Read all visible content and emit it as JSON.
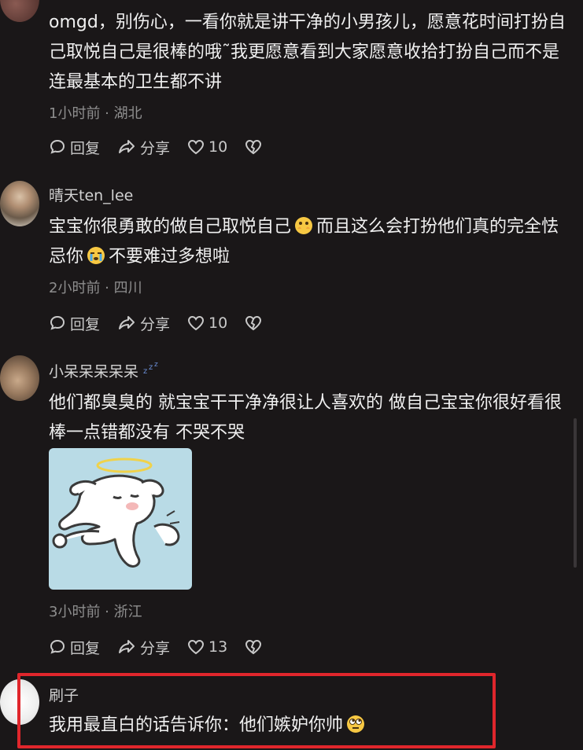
{
  "comments": [
    {
      "username": "",
      "text": "omgd，别伤心，一看你就是讲干净的小男孩儿，愿意花时间打扮自己取悦自己是很棒的哦˜我更愿意看到大家愿意收拾打扮自己而不是连最基本的卫生都不讲",
      "meta": "1小时前 · 湖北",
      "reply": "回复",
      "share": "分享",
      "likes": "10"
    },
    {
      "username": "晴天ten_lee",
      "text_a": "宝宝你很勇敢的做自己取悦自己",
      "text_b": "而且这么会打扮他们真的完全怯忌你",
      "text_c": "不要难过多想啦",
      "emoji_a": "hands-over-mouth-emoji",
      "emoji_b": "crying-emoji",
      "meta": "2小时前 · 四川",
      "reply": "回复",
      "share": "分享",
      "likes": "10"
    },
    {
      "username": "小呆呆呆呆呆",
      "username_badge": "sleeping-zzz-icon",
      "text": "他们都臭臭的 就宝宝干干净净很让人喜欢的 做自己宝宝你很好看很棒一点错都没有 不哭不哭",
      "sticker": "angel-dog-sticker",
      "meta": "3小时前 · 浙江",
      "reply": "回复",
      "share": "分享",
      "likes": "13"
    },
    {
      "username": "刷子",
      "text": "我用最直白的话告诉你：他们嫉妒你帅",
      "emoji": "rolling-eyes-emoji"
    }
  ],
  "colors": {
    "background": "#1a1718",
    "highlight": "#e0262c"
  }
}
